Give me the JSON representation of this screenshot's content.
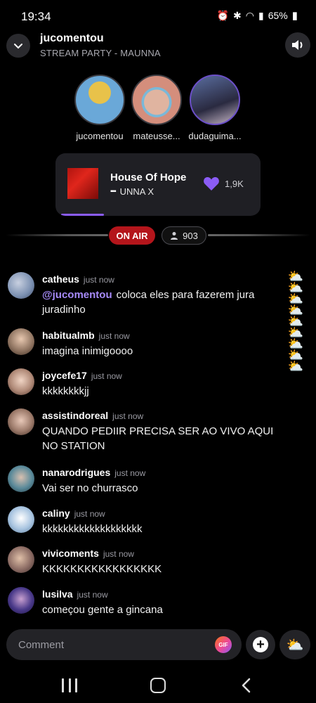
{
  "status_bar": {
    "time": "19:34",
    "battery": "65%",
    "icons": [
      "alarm-icon",
      "bluetooth-icon",
      "wifi-icon",
      "signal-icon",
      "battery-icon"
    ]
  },
  "header": {
    "title": "jucomentou",
    "subtitle": "STREAM PARTY - MAUNNA"
  },
  "hosts": [
    {
      "name": "jucomentou",
      "avatar_color": "#6aa8d8"
    },
    {
      "name": "mateusse...",
      "avatar_color": "#d48e7c"
    },
    {
      "name": "dudaguima...",
      "avatar_color": "#5a6ea0"
    }
  ],
  "now_playing": {
    "title": "House Of Hope",
    "artist": "UNNA X",
    "explicit_mark": "▪▪▪",
    "likes": "1,9K",
    "progress": 0.22
  },
  "live": {
    "on_air_label": "ON AIR",
    "viewers": "903"
  },
  "comments": [
    {
      "user": "catheus",
      "time": "just now",
      "mention": "@jucomentou",
      "text": "coloca eles para fazerem jura juradinho",
      "avatar_color": "#7a8fb0"
    },
    {
      "user": "habitualmb",
      "time": "just now",
      "mention": "",
      "text": "imagina inimigoooo",
      "avatar_color": "#8a6f5c"
    },
    {
      "user": "joycefe17",
      "time": "just now",
      "mention": "",
      "text": "kkkkkkkkjj",
      "avatar_color": "#b08a78"
    },
    {
      "user": "assistindoreal",
      "time": "just now",
      "mention": "",
      "text": "QUANDO PEDIIR PRECISA SER AO VIVO AQUI NO STATION",
      "avatar_color": "#9c7a6a"
    },
    {
      "user": "nanarodrigues",
      "time": "just now",
      "mention": "",
      "text": "Vai ser no churrasco",
      "avatar_color": "#5a8a9a"
    },
    {
      "user": "caliny",
      "time": "just now",
      "mention": "",
      "text": "kkkkkkkkkkkkkkkkkkk",
      "avatar_color": "#a8c4e0"
    },
    {
      "user": "vivicoments",
      "time": "just now",
      "mention": "",
      "text": "KKKKKKKKKKKKKKKKK",
      "avatar_color": "#8c6c64"
    },
    {
      "user": "lusilva",
      "time": "just now",
      "mention": "",
      "text": "começou  gente a gincana",
      "avatar_color": "#4a3a8a"
    }
  ],
  "composer": {
    "placeholder": "Comment",
    "gif_label": "GIF",
    "plus_label": "+"
  },
  "weather_emoji": "⛅",
  "colors": {
    "accent": "#8b5cf6",
    "on_air": "#b4151b",
    "background": "#000000",
    "card": "#1f1f24"
  }
}
